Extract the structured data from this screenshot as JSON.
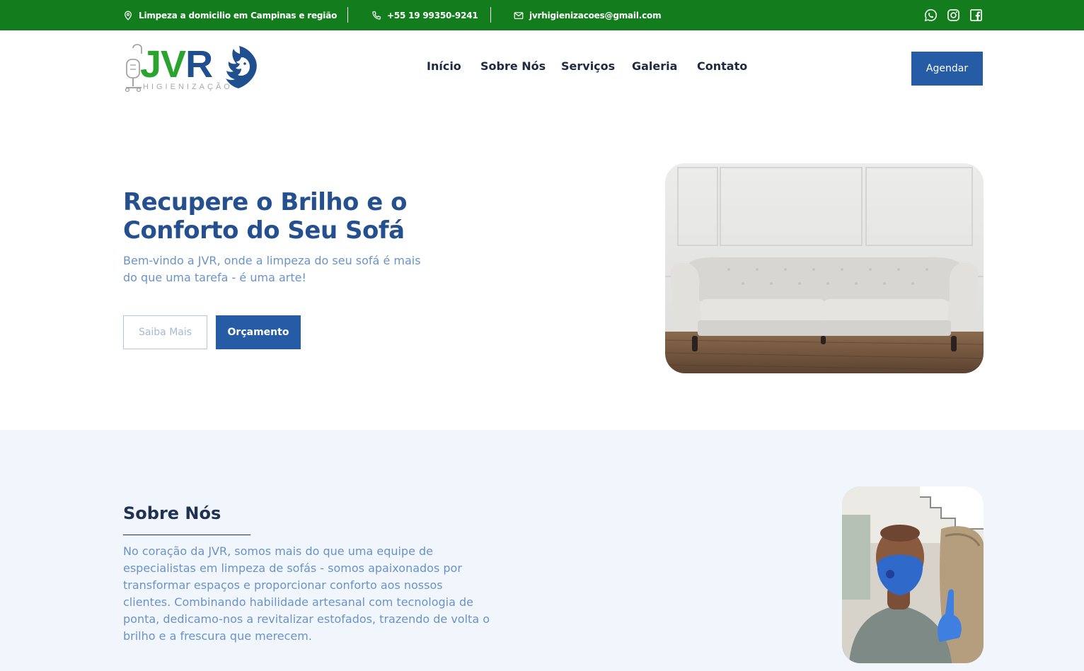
{
  "topbar": {
    "location": "Limpeza a domicilio em Campinas e região",
    "phone": "+55 19 99350-9241",
    "email": "jvrhigienizacoes@gmail.com",
    "social": [
      "whatsapp-icon",
      "instagram-icon",
      "facebook-icon"
    ],
    "color": "#137c1d"
  },
  "logo": {
    "brand_jv": "JV",
    "brand_r": "R",
    "sub": "HIGIENIZAÇÃO"
  },
  "nav": {
    "items": [
      "Início",
      "Sobre Nós",
      "Serviços",
      "Galeria",
      "Contato"
    ],
    "cta": "Agendar"
  },
  "hero": {
    "title_line1": "Recupere o Brilho e o",
    "title_line2": "Conforto do Seu Sofá",
    "subtitle": "Bem-vindo a JVR, onde a limpeza do seu sofá é mais do que uma tarefa - é uma arte!",
    "btn_secondary": "Saiba Mais",
    "btn_primary": "Orçamento"
  },
  "about": {
    "title": "Sobre Nós",
    "text": "No coração da JVR, somos mais do que uma equipe de especialistas em limpeza de sofás - somos apaixonados por transformar espaços e proporcionar conforto aos nossos clientes. Combinando habilidade artesanal com tecnologia de ponta, dedicamo-nos a revitalizar estofados, trazendo de volta o brilho e a frescura que merecem."
  },
  "colors": {
    "primary_blue": "#265ba6",
    "title_blue": "#25508f",
    "text_blue": "#6a93c7",
    "green": "#137c1d",
    "about_bg": "#f1f5fc"
  }
}
